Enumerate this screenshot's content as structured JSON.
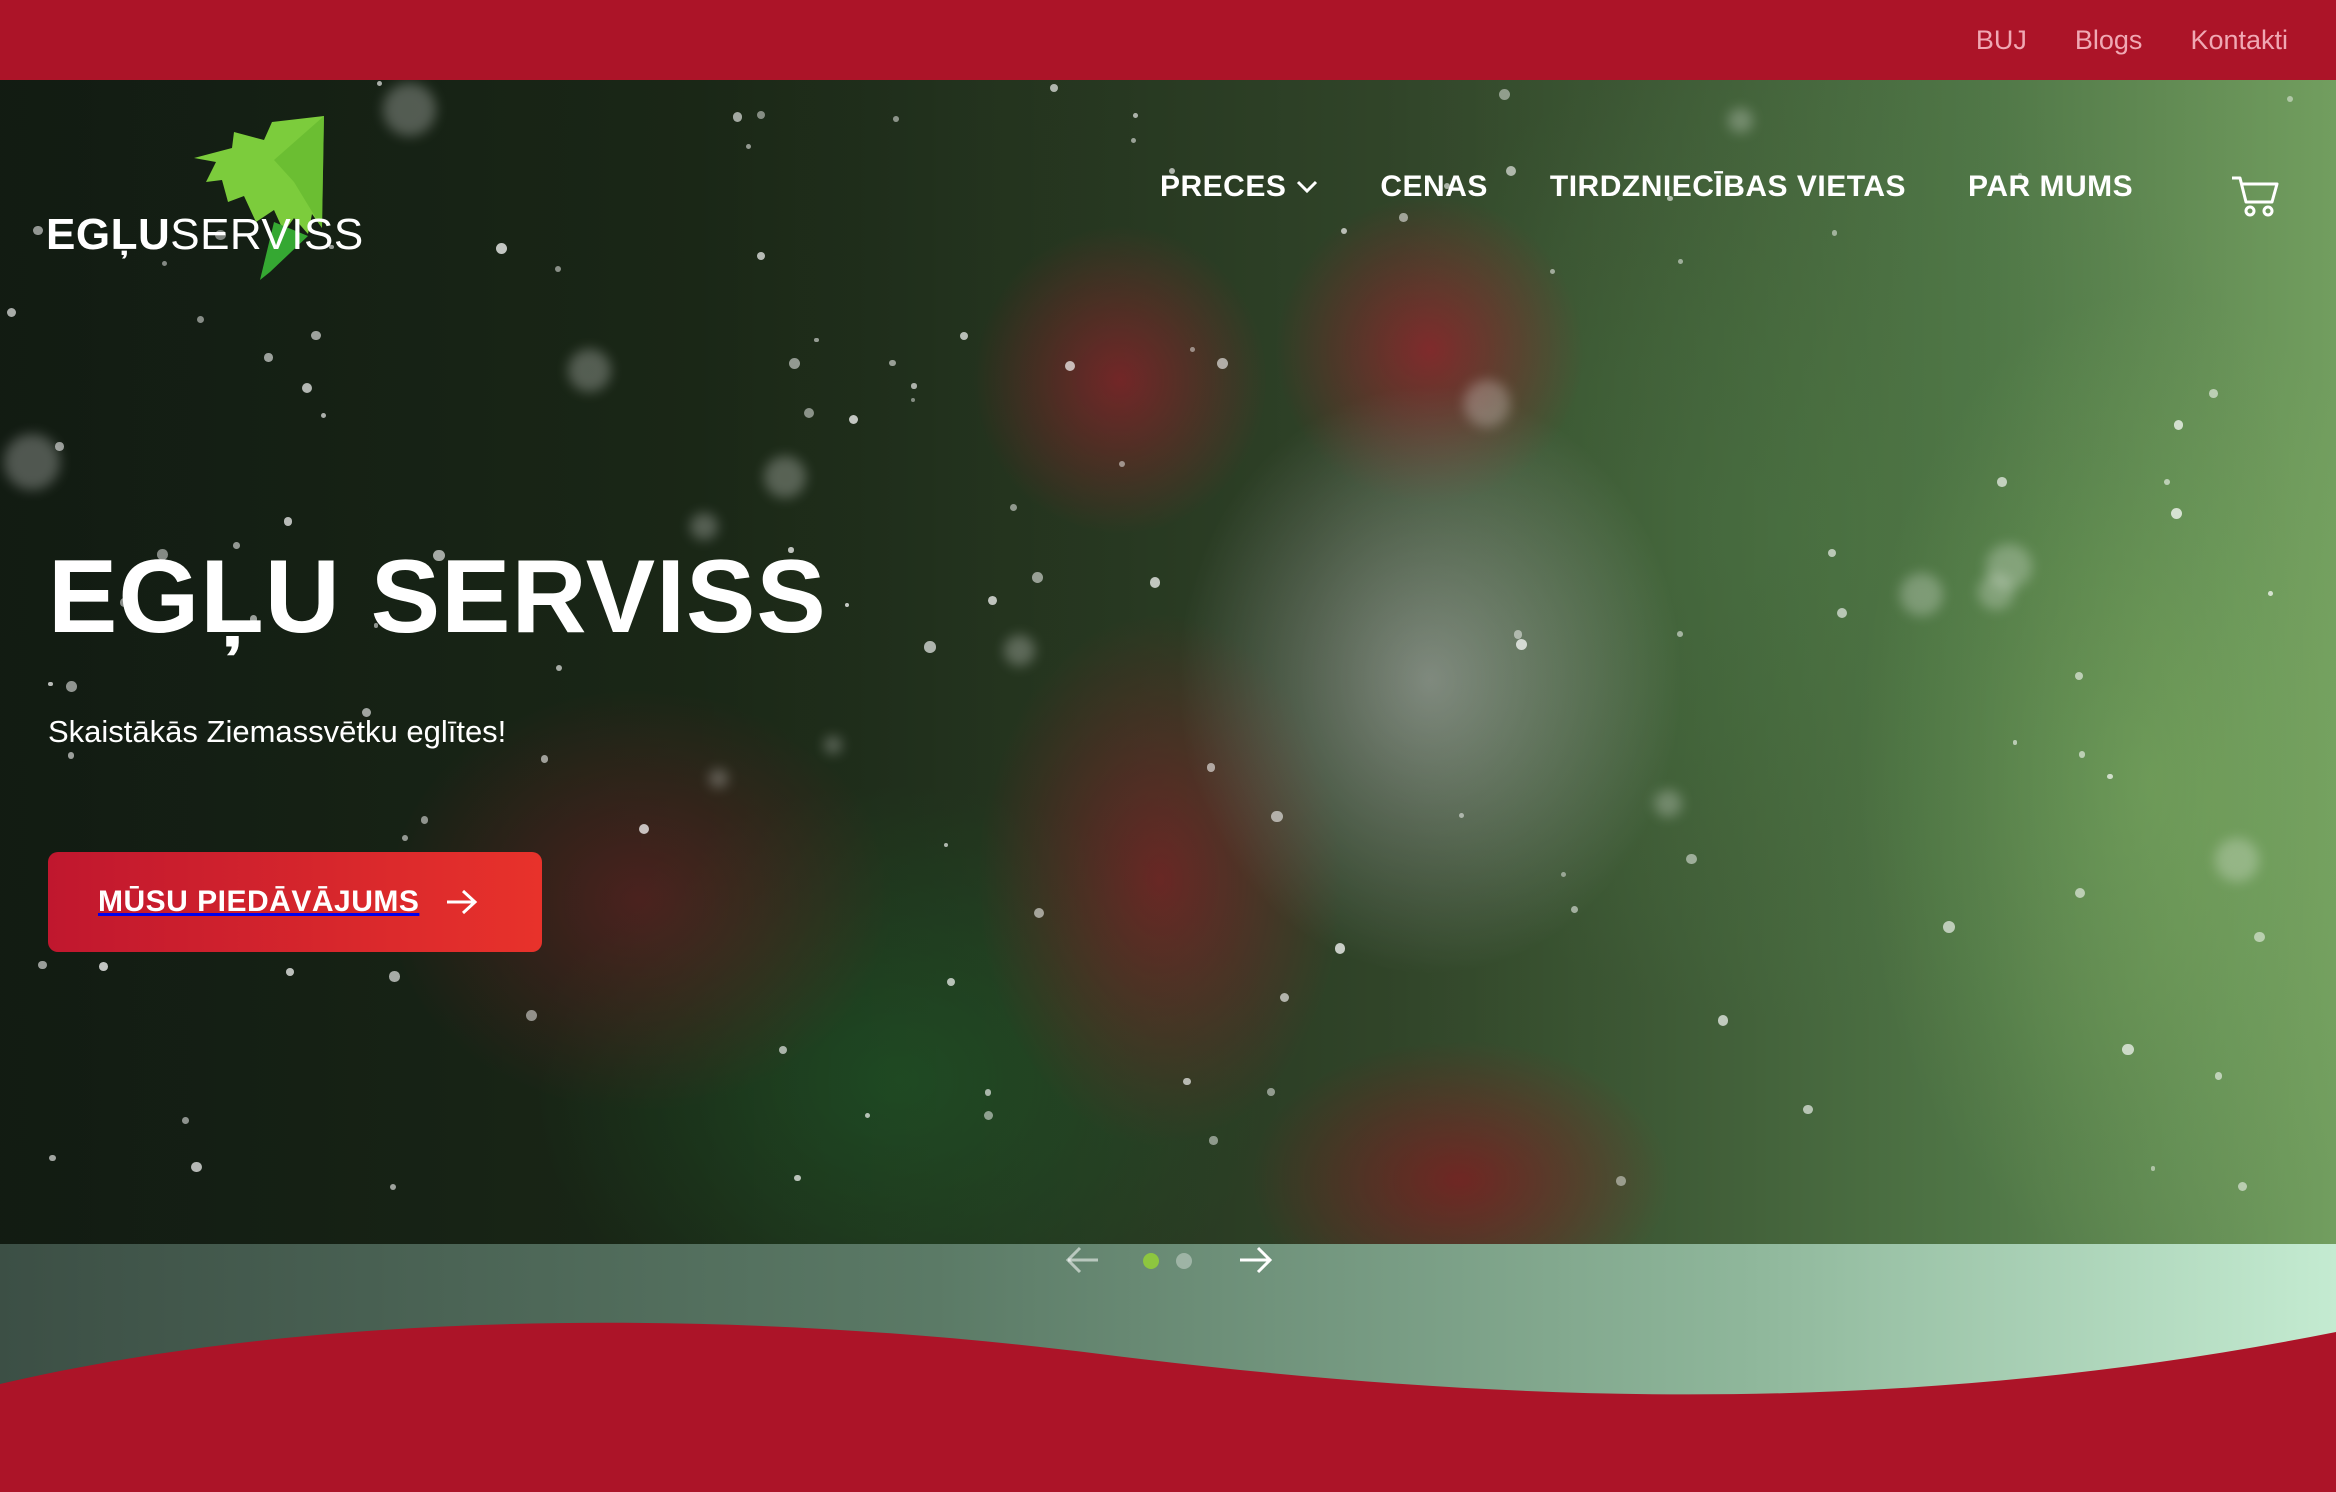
{
  "topbar": {
    "links": [
      "BUJ",
      "Blogs",
      "Kontakti"
    ]
  },
  "logo": {
    "part1": "EGĻU",
    "part2": "SERVISS"
  },
  "nav": {
    "items": [
      "PRECES",
      "CENAS",
      "TIRDZNIECĪBAS VIETAS",
      "PAR MUMS"
    ]
  },
  "hero": {
    "title": "EGĻU SERVISS",
    "subtitle": "Skaistākās Ziemassvētku eglītes!",
    "cta_label": "MŪSU PIEDĀVĀJUMS"
  },
  "slider": {
    "active_slide": 1,
    "slide_count": 2
  },
  "colors": {
    "brand_red": "#ac1428",
    "accent_green": "#8dc63f",
    "cta_start": "#c0172e",
    "cta_end": "#e8322b"
  },
  "icons": {
    "cart": "cart-icon",
    "dropdown": "chevron-down-icon",
    "cta_arrow": "arrow-right-icon",
    "prev": "arrow-left-icon",
    "next": "arrow-right-icon"
  }
}
